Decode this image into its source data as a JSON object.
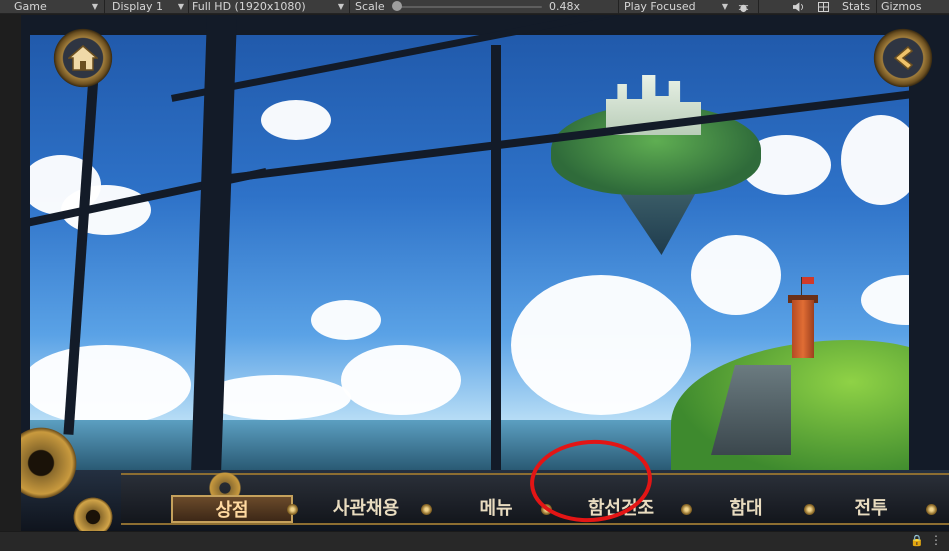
{
  "toolbar": {
    "view_select": "Game",
    "display_select": "Display 1",
    "resolution_select": "Full HD (1920x1080)",
    "scale_label": "Scale",
    "scale_value": 0.48,
    "scale_text": "0.48x",
    "play_mode_select": "Play Focused",
    "stats_label": "Stats",
    "gizmos_label": "Gizmos"
  },
  "game": {
    "menu_items": [
      "상점",
      "사관채용",
      "메뉴",
      "함선건조",
      "함대",
      "전투"
    ],
    "active_item": "상점"
  },
  "colors": {
    "annotation": "#e31515",
    "menu_border": "#8d6e32",
    "menu_text": "#e9dcc0"
  }
}
